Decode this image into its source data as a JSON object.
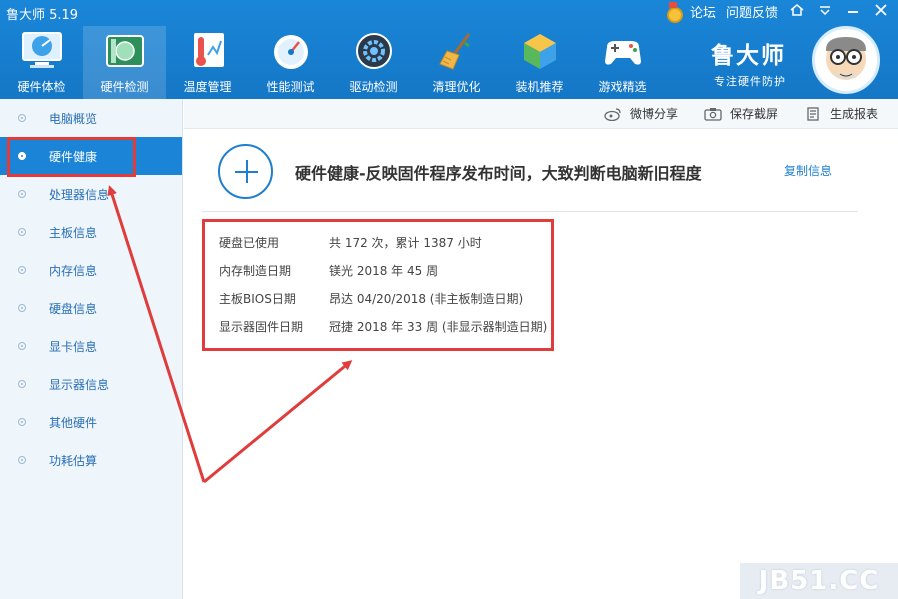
{
  "window": {
    "title": "鲁大师 5.19",
    "links": [
      "论坛",
      "问题反馈"
    ]
  },
  "toolbar": {
    "items": [
      {
        "label": "硬件体检",
        "icon": "monitor-radar-icon"
      },
      {
        "label": "硬件检测",
        "icon": "circuit-board-icon"
      },
      {
        "label": "温度管理",
        "icon": "thermometer-icon"
      },
      {
        "label": "性能测试",
        "icon": "speedometer-icon"
      },
      {
        "label": "驱动检测",
        "icon": "gear-drive-icon"
      },
      {
        "label": "清理优化",
        "icon": "broom-icon"
      },
      {
        "label": "装机推荐",
        "icon": "cube-icon"
      },
      {
        "label": "游戏精选",
        "icon": "gamepad-icon"
      }
    ],
    "active_index": 1
  },
  "brand": {
    "name": "鲁大师",
    "tagline": "专注硬件防护"
  },
  "sidebar": {
    "items": [
      {
        "label": "电脑概览"
      },
      {
        "label": "硬件健康"
      },
      {
        "label": "处理器信息"
      },
      {
        "label": "主板信息"
      },
      {
        "label": "内存信息"
      },
      {
        "label": "硬盘信息"
      },
      {
        "label": "显卡信息"
      },
      {
        "label": "显示器信息"
      },
      {
        "label": "其他硬件"
      },
      {
        "label": "功耗估算"
      }
    ],
    "active_index": 1
  },
  "actions": {
    "share": "微博分享",
    "screenshot": "保存截屏",
    "report": "生成报表"
  },
  "main": {
    "title": "硬件健康-反映固件程序发布时间，大致判断电脑新旧程度",
    "copy_link": "复制信息",
    "rows": [
      {
        "key": "硬盘已使用",
        "value": "共 172 次，累计 1387 小时"
      },
      {
        "key": "内存制造日期",
        "value": "镁光 2018 年 45 周"
      },
      {
        "key": "主板BIOS日期",
        "value": "昂达 04/20/2018 (非主板制造日期)"
      },
      {
        "key": "显示器固件日期",
        "value": "冠捷 2018 年 33 周 (非显示器制造日期)"
      }
    ]
  },
  "watermark": "JB51.CC",
  "colors": {
    "header": "#1a86d8",
    "accent": "#1f7fcc",
    "highlight": "#e03c3c",
    "sidebar_bg": "#eef5fb"
  }
}
